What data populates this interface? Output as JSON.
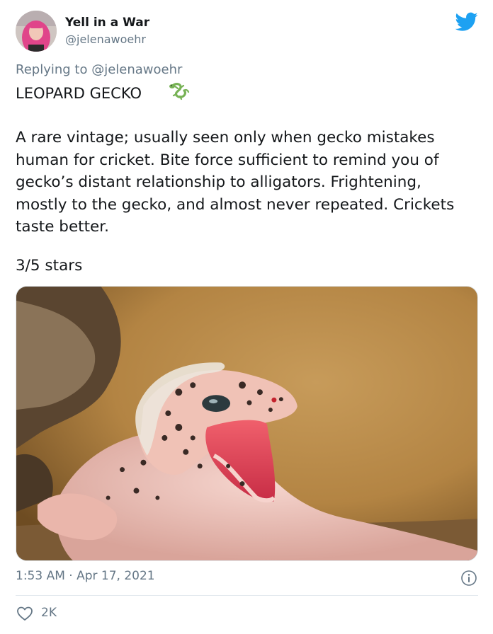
{
  "author": {
    "display_name": "Yell in a War",
    "handle": "@jelenawoehr"
  },
  "reply_context": {
    "prefix": "Replying to",
    "mention": "@jelenawoehr"
  },
  "tweet": {
    "headline": "LEOPARD GECKO",
    "headline_emoji": "lizard-emoji",
    "body": "A rare vintage; usually seen only when gecko mistakes human for cricket. Bite force sufficient to remind you of gecko’s distant relationship to alligators. Frightening, mostly to the gecko, and almost never repeated. Crickets taste better.",
    "rating": "3/5 stars",
    "image": "photo-of-leopard-gecko-with-open-mouth"
  },
  "meta": {
    "timestamp": "1:53 AM · Apr 17, 2021"
  },
  "actions": {
    "like_count": "2K"
  },
  "icons": {
    "brand": "twitter-bird-icon",
    "info": "info-icon",
    "like": "heart-icon"
  },
  "colors": {
    "brand_blue": "#1da1f2",
    "secondary_text": "#657786",
    "primary_text": "#14171a",
    "divider": "#e1e8ed",
    "emoji_green": "#77b255"
  }
}
